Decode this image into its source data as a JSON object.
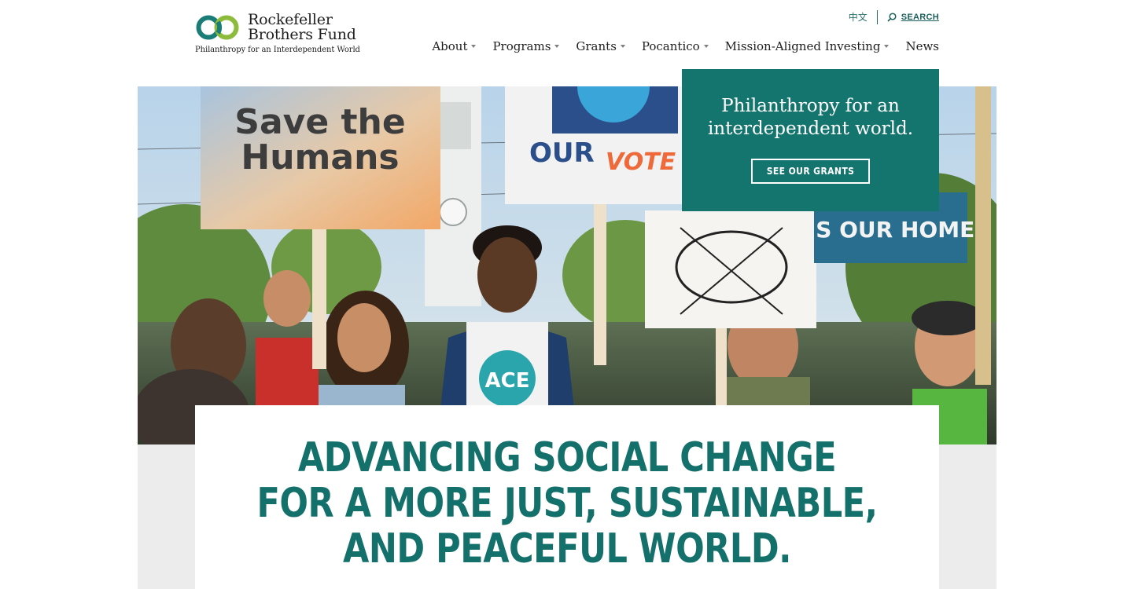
{
  "logo": {
    "name_line1": "Rockefeller",
    "name_line2": "Brothers Fund",
    "tagline": "Philanthropy for an Interdependent World",
    "icon": "infinity-rings-logo"
  },
  "utility": {
    "language_label": "中文",
    "search_label": "SEARCH",
    "search_icon": "search-icon"
  },
  "nav": {
    "items": [
      {
        "label": "About",
        "has_dropdown": true
      },
      {
        "label": "Programs",
        "has_dropdown": true
      },
      {
        "label": "Grants",
        "has_dropdown": true
      },
      {
        "label": "Pocantico",
        "has_dropdown": true
      },
      {
        "label": "Mission-Aligned Investing",
        "has_dropdown": true
      },
      {
        "label": "News",
        "has_dropdown": false
      }
    ]
  },
  "hero": {
    "sign_save_line1": "Save the",
    "sign_save_line2": "Humans",
    "sign_vote_our": "OUR",
    "sign_vote_vote": "VOTE",
    "sign_home": "IS OUR HOME",
    "shirt_text": "ACE"
  },
  "callout": {
    "text": "Philanthropy for an interdependent world.",
    "button_label": "SEE OUR GRANTS"
  },
  "mission": {
    "line1": "ADVANCING SOCIAL CHANGE",
    "line2": "FOR A MORE JUST, SUSTAINABLE,",
    "line3": "AND PEACEFUL WORLD."
  },
  "colors": {
    "brand_teal": "#14756f",
    "heading_teal": "#14706b",
    "link_teal": "#1c5f5c"
  }
}
